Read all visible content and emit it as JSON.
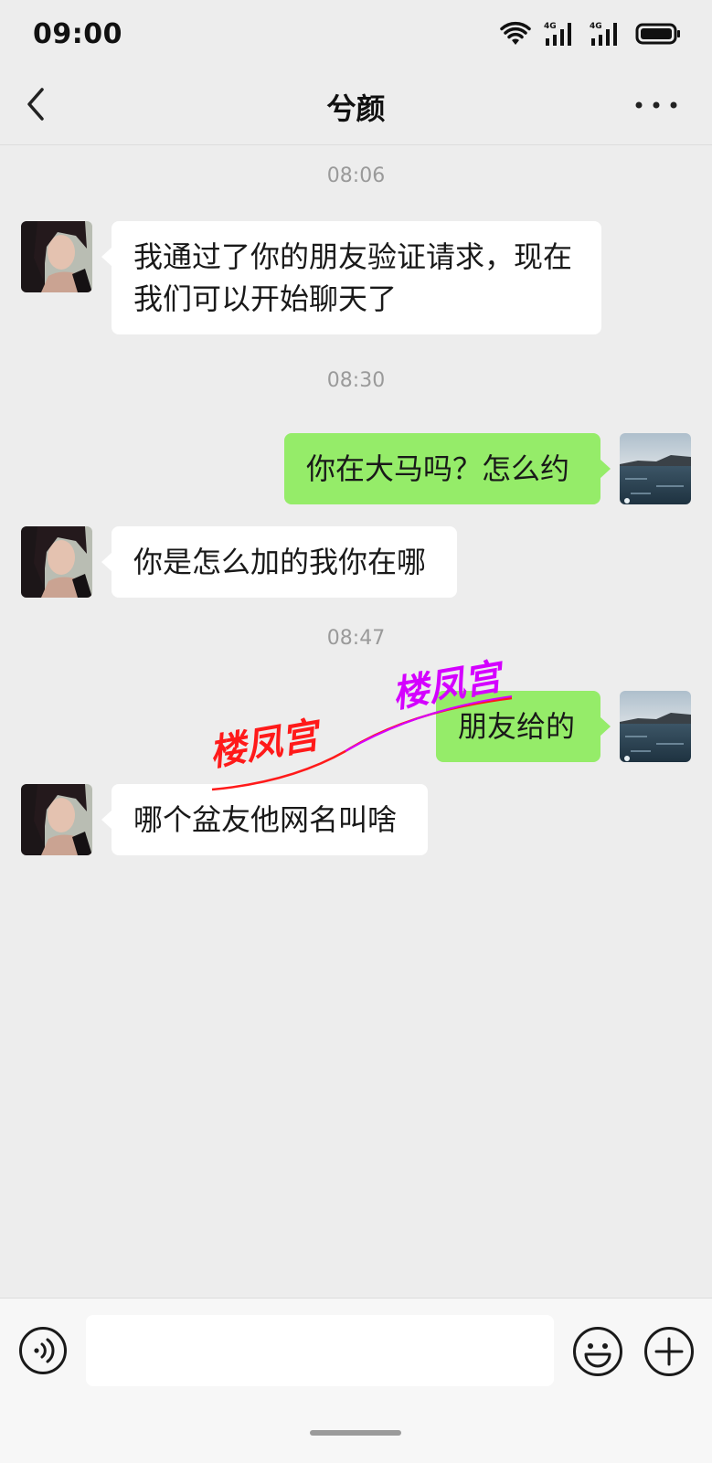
{
  "status_bar": {
    "time": "09:00",
    "network_labels": [
      "4G",
      "4G"
    ]
  },
  "nav": {
    "title": "兮颜",
    "back_icon": "chevron-left-icon",
    "more_icon": "more-dots-icon"
  },
  "messages": [
    {
      "type": "timestamp",
      "text": "08:06"
    },
    {
      "type": "message",
      "side": "left",
      "avatar": "contact-avatar",
      "text": "我通过了你的朋友验证请求，现在我们可以开始聊天了"
    },
    {
      "type": "timestamp",
      "text": "08:30"
    },
    {
      "type": "message",
      "side": "right",
      "avatar": "user-avatar",
      "text": "你在大马吗？怎么约"
    },
    {
      "type": "message",
      "side": "left",
      "avatar": "contact-avatar",
      "text": "你是怎么加的我你在哪"
    },
    {
      "type": "timestamp",
      "text": "08:47"
    },
    {
      "type": "message",
      "side": "right",
      "avatar": "user-avatar",
      "text": "朋友给的"
    },
    {
      "type": "message",
      "side": "left",
      "avatar": "contact-avatar",
      "text": "哪个盆友他网名叫啥"
    }
  ],
  "watermark": {
    "text_red": "楼凤宫",
    "text_purple": "楼凤宫",
    "colors": {
      "red": "#ff1a1a",
      "purple": "#d400ff"
    }
  },
  "input_bar": {
    "value": "",
    "voice_icon": "voice-icon",
    "emoji_icon": "emoji-icon",
    "plus_icon": "plus-icon"
  },
  "colors": {
    "background": "#ededed",
    "bubble_self": "#95ec69",
    "bubble_other": "#ffffff",
    "timestamp": "#9a9a9a"
  }
}
